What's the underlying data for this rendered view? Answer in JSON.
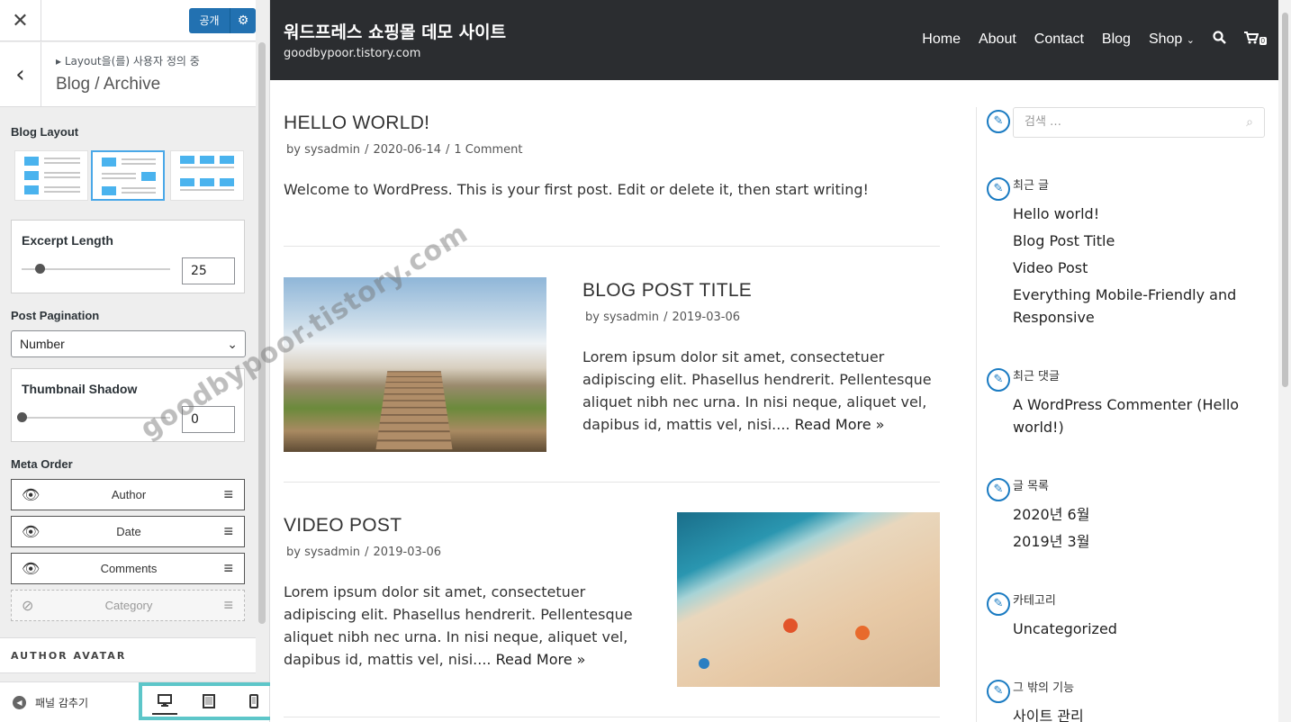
{
  "customizer": {
    "close_icon": "close-icon",
    "publish_label": "공개",
    "breadcrumb": "▸ Layout을(를) 사용자 정의 중",
    "section_title": "Blog / Archive",
    "blog_layout_label": "Blog Layout",
    "excerpt": {
      "label": "Excerpt Length",
      "value": "25",
      "level": 0.12
    },
    "post_pagination": {
      "label": "Post Pagination",
      "selected": "Number"
    },
    "thumbnail_shadow": {
      "label": "Thumbnail Shadow",
      "value": "0",
      "level": 0.0
    },
    "meta_order": {
      "label": "Meta Order",
      "items": [
        {
          "label": "Author",
          "visible": true
        },
        {
          "label": "Date",
          "visible": true
        },
        {
          "label": "Comments",
          "visible": true
        },
        {
          "label": "Category",
          "visible": false
        }
      ]
    },
    "author_avatar_label": "AUTHOR AVATAR",
    "collapse_label": "패널 감추기"
  },
  "site": {
    "title": "워드프레스 쇼핑몰 데모 사이트",
    "tagline": "goodbypoor.tistory.com",
    "nav": [
      "Home",
      "About",
      "Contact",
      "Blog",
      "Shop"
    ],
    "cart_count": "0"
  },
  "posts": [
    {
      "title": "HELLO WORLD!",
      "author": "by sysadmin",
      "date": "2020-06-14",
      "comments": "1 Comment",
      "excerpt": "Welcome to WordPress. This is your first post. Edit or delete it, then start writing!"
    },
    {
      "title": "BLOG POST TITLE",
      "author": "by sysadmin",
      "date": "2019-03-06",
      "excerpt": "Lorem ipsum dolor sit amet, consectetuer adipiscing elit. Phasellus hendrerit. Pellentesque aliquet nibh nec urna. In nisi neque, aliquet vel, dapibus id, mattis vel, nisi.... ",
      "read_more": "Read More »"
    },
    {
      "title": "VIDEO POST",
      "author": "by sysadmin",
      "date": "2019-03-06",
      "excerpt": "Lorem ipsum dolor sit amet, consectetuer adipiscing elit. Phasellus hendrerit. Pellentesque aliquet nibh nec urna. In nisi neque, aliquet vel, dapibus id, mattis vel, nisi.... ",
      "read_more": "Read More »"
    }
  ],
  "widgets": {
    "search_placeholder": "검색 …",
    "recent_posts": {
      "title": "최근 글",
      "items": [
        "Hello world!",
        "Blog Post Title",
        "Video Post",
        "Everything Mobile-Friendly and Responsive"
      ]
    },
    "recent_comments": {
      "title": "최근 댓글",
      "text": "A WordPress Commenter (Hello world!)"
    },
    "archives": {
      "title": "글 목록",
      "items": [
        "2020년 6월",
        "2019년 3월"
      ]
    },
    "categories": {
      "title": "카테고리",
      "items": [
        "Uncategorized"
      ]
    },
    "meta": {
      "title": "그 밖의 기능",
      "items": [
        "사이트 관리"
      ]
    }
  },
  "watermark": "goodbypoor.tistory.com",
  "colors": {
    "accent": "#2271b1",
    "header_bg": "#2b2d30",
    "highlight": "#5dc6c9",
    "layout_blue": "#4ab3ee"
  }
}
